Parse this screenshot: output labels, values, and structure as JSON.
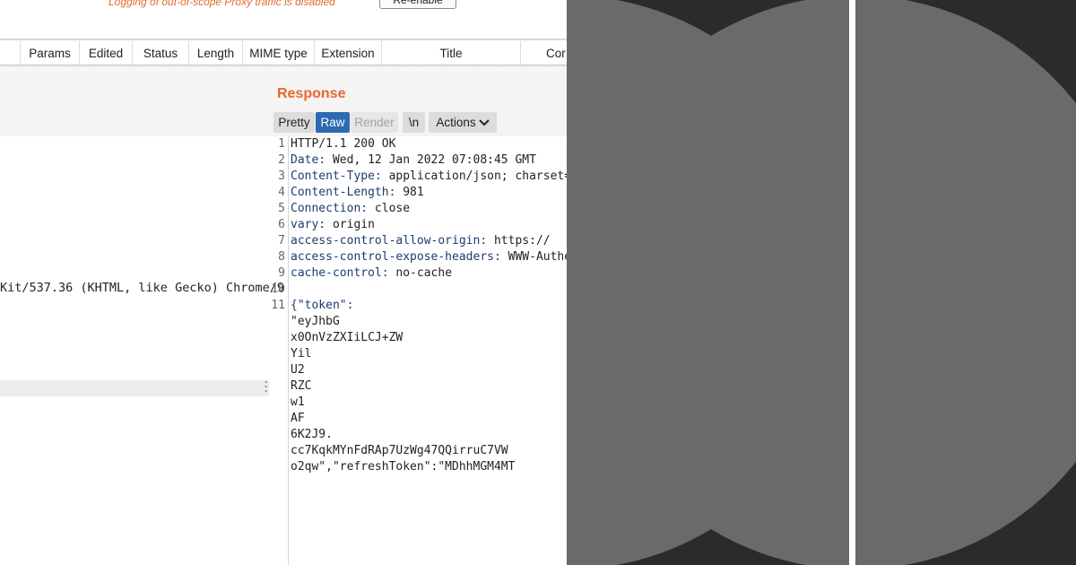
{
  "banner": {
    "message": "Logging of out-of-scope Proxy traffic is disabled",
    "reenable_label": "Re-enable"
  },
  "columns": [
    "Params",
    "Edited",
    "Status",
    "Length",
    "MIME type",
    "Extension",
    "Title",
    "Cor"
  ],
  "request": {
    "visible_fragment": "Kit/537.36 (KHTML, like Gecko) Chrome/9",
    "line_number": "10"
  },
  "response": {
    "title": "Response",
    "tabs": {
      "pretty": "Pretty",
      "raw": "Raw",
      "render": "Render",
      "newline": "\\n",
      "actions": "Actions"
    },
    "lines": [
      {
        "n": "1",
        "name": "HTTP/1.1 200 OK",
        "value": ""
      },
      {
        "n": "2",
        "name": "Date:",
        "value": " Wed, 12 Jan 2022 07:08:45 GMT"
      },
      {
        "n": "3",
        "name": "Content-Type:",
        "value": " application/json; charset="
      },
      {
        "n": "4",
        "name": "Content-Length:",
        "value": " 981"
      },
      {
        "n": "5",
        "name": "Connection:",
        "value": " close"
      },
      {
        "n": "6",
        "name": "vary:",
        "value": " origin"
      },
      {
        "n": "7",
        "name": "access-control-allow-origin:",
        "value": " https://"
      },
      {
        "n": "8",
        "name": "access-control-expose-headers:",
        "value": " WWW-Authe"
      },
      {
        "n": "9",
        "name": "cache-control:",
        "value": " no-cache"
      },
      {
        "n": "10",
        "name": "",
        "value": ""
      },
      {
        "n": "11",
        "name": "{\"token\":",
        "value": ""
      }
    ],
    "body_fragments": [
      "\"eyJhbG",
      "x0OnVzZXIiLCJ+ZW",
      "Yil",
      "U2",
      "RZC",
      "w1",
      "AF",
      "6K2J9.",
      "cc7KqkMYnFdRAp7UzWg47QQirruC7VW",
      "o2qw\",\"refreshToken\":\"MDhhMGM4MT"
    ]
  },
  "colors": {
    "accent_orange": "#e8672d",
    "raw_tab_blue": "#2d6bb0",
    "deco_background": "#2b2b2b",
    "deco_shape": "#6a6a6a"
  }
}
